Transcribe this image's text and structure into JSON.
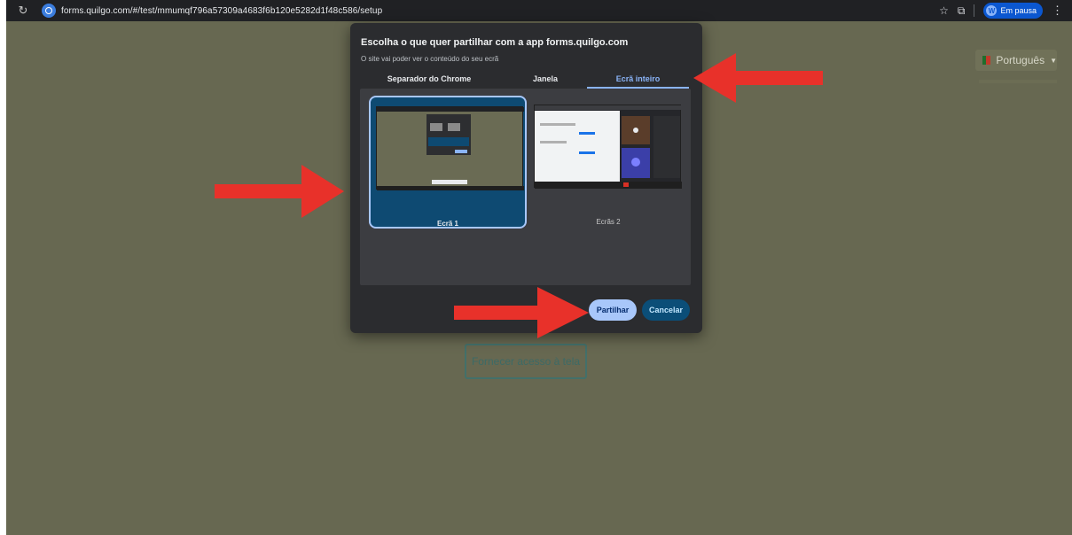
{
  "browser": {
    "url": "forms.quilgo.com/#/test/mmumqf796a57309a4683f6b120e5282d1f48c586/setup",
    "profile_initial": "W",
    "profile_label": "Em pausa"
  },
  "page": {
    "language_label": "Português",
    "screen_access_button": "Fornecer acesso à tela"
  },
  "dialog": {
    "title": "Escolha o que quer partilhar com a app forms.quilgo.com",
    "subtitle": "O site vai poder ver o conteúdo do seu ecrã",
    "tabs": [
      {
        "label": "Separador do Chrome",
        "active": false
      },
      {
        "label": "Janela",
        "active": false
      },
      {
        "label": "Ecrã inteiro",
        "active": true
      }
    ],
    "screens": [
      {
        "label": "Ecrã 1",
        "selected": true
      },
      {
        "label": "Ecrãs 2",
        "selected": false
      }
    ],
    "share_button": "Partilhar",
    "cancel_button": "Cancelar"
  },
  "colors": {
    "dimmed_page": "#676851",
    "dialog_bg": "#2b2c2f",
    "accent": "#8ab4f8",
    "arrow": "#e8312a"
  }
}
